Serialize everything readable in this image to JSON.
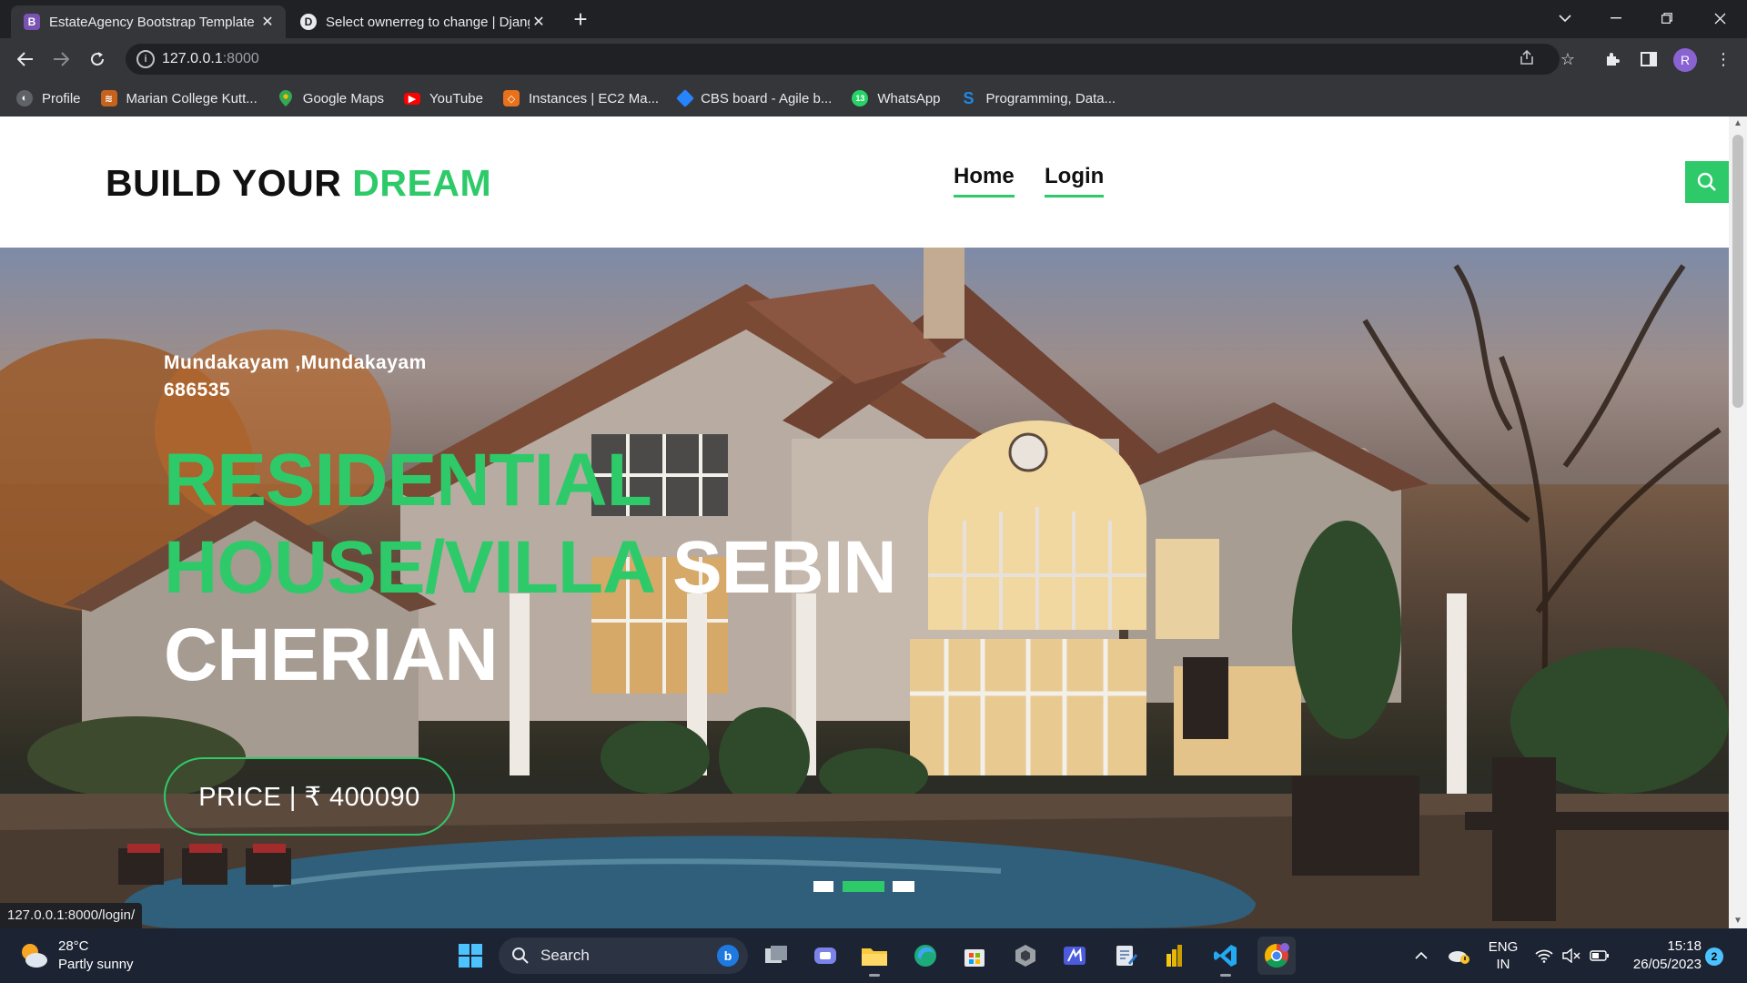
{
  "browser": {
    "tabs": [
      {
        "title": "EstateAgency Bootstrap Template",
        "favicon": "B",
        "favicon_color": "#7952b3",
        "active": true
      },
      {
        "title": "Select ownerreg to change | Django site admin",
        "favicon": "D",
        "favicon_color": "#e8eaed",
        "active": false
      }
    ],
    "url_host": "127.0.0.1",
    "url_port": ":8000",
    "profile_initial": "R",
    "bookmarks": [
      {
        "label": "Profile",
        "icon": "globe-icon",
        "color": "#5f6368"
      },
      {
        "label": "Marian College Kutt...",
        "icon": "college-icon",
        "color": "#c6621b"
      },
      {
        "label": "Google Maps",
        "icon": "maps-icon",
        "color": "#34a853"
      },
      {
        "label": "YouTube",
        "icon": "youtube-icon",
        "color": "#ff0000"
      },
      {
        "label": "Instances | EC2 Ma...",
        "icon": "aws-icon",
        "color": "#e8711a"
      },
      {
        "label": "CBS board - Agile b...",
        "icon": "jira-icon",
        "color": "#2684ff"
      },
      {
        "label": "WhatsApp",
        "icon": "whatsapp-icon",
        "color": "#25d366",
        "badge": "13"
      },
      {
        "label": "Programming, Data...",
        "icon": "s-icon",
        "color": "#1e88e5"
      }
    ]
  },
  "site": {
    "brand_part1": "BUILD YOUR ",
    "brand_part2": "DREAM",
    "nav": [
      "Home",
      "Login"
    ],
    "accent_color": "#2eca6a"
  },
  "hero": {
    "location": "Mundakayam ,Mundakayam 686535",
    "title_green": "RESIDENTIAL HOUSE/VILLA",
    "title_white": " SEBIN CHERIAN",
    "price": "PRICE | ₹ 400090",
    "carousel_slides": 3,
    "carousel_active": 2
  },
  "status_url": "127.0.0.1:8000/login/",
  "taskbar": {
    "weather_temp": "28°C",
    "weather_desc": "Partly sunny",
    "search_label": "Search",
    "lang_line1": "ENG",
    "lang_line2": "IN",
    "time": "15:18",
    "date": "26/05/2023",
    "notifications": "2"
  }
}
